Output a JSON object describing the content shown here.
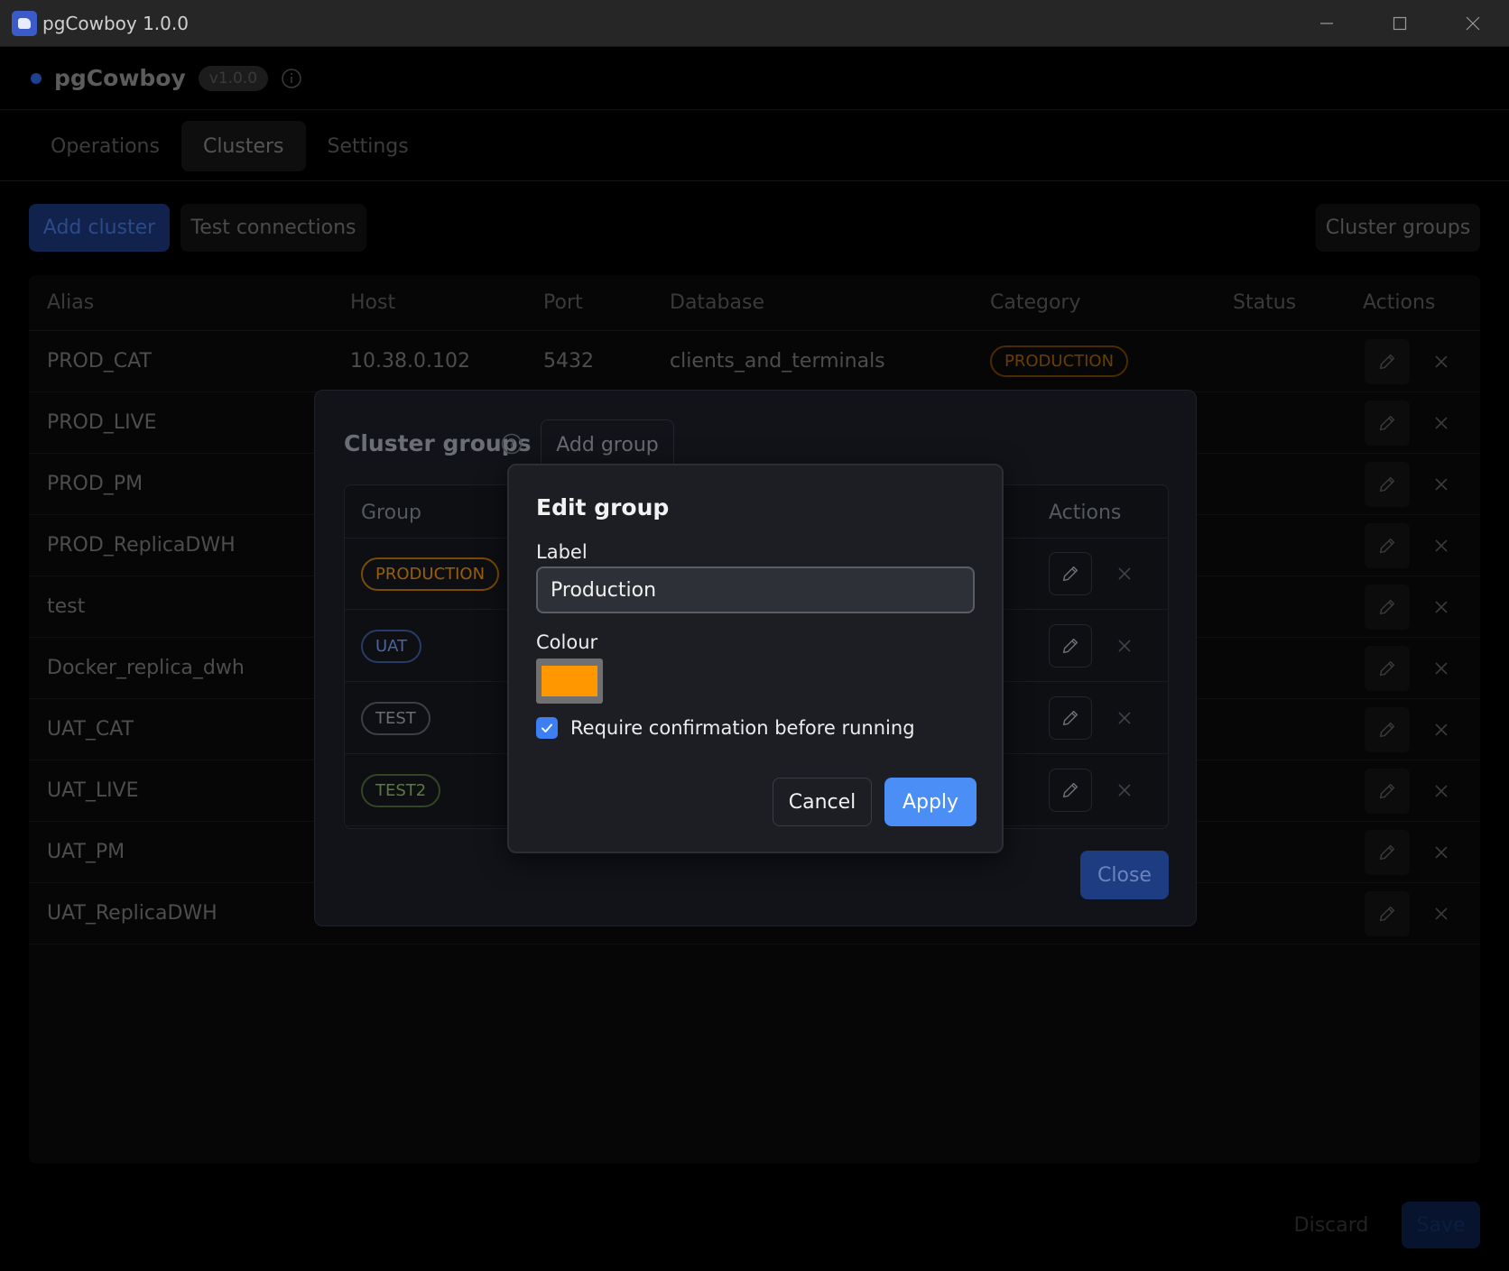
{
  "window": {
    "title": "pgCowboy 1.0.0"
  },
  "header": {
    "brand": "pgCowboy",
    "version": "v1.0.0"
  },
  "tabs": [
    {
      "label": "Operations",
      "active": false
    },
    {
      "label": "Clusters",
      "active": true
    },
    {
      "label": "Settings",
      "active": false
    }
  ],
  "toolbar": {
    "add_cluster": "Add cluster",
    "test_connections": "Test connections",
    "cluster_groups": "Cluster groups"
  },
  "clusters_table": {
    "columns": [
      "Alias",
      "Host",
      "Port",
      "Database",
      "Category",
      "Status",
      "Actions"
    ],
    "rows": [
      {
        "alias": "PROD_CAT",
        "host": "10.38.0.102",
        "port": "5432",
        "database": "clients_and_terminals",
        "category": "PRODUCTION"
      },
      {
        "alias": "PROD_LIVE"
      },
      {
        "alias": "PROD_PM"
      },
      {
        "alias": "PROD_ReplicaDWH"
      },
      {
        "alias": "test"
      },
      {
        "alias": "Docker_replica_dwh"
      },
      {
        "alias": "UAT_CAT"
      },
      {
        "alias": "UAT_LIVE"
      },
      {
        "alias": "UAT_PM"
      },
      {
        "alias": "UAT_ReplicaDWH"
      }
    ]
  },
  "footer": {
    "discard": "Discard",
    "save": "Save"
  },
  "groups_modal": {
    "title": "Cluster groups",
    "add_group": "Add group",
    "columns": {
      "group": "Group",
      "actions": "Actions"
    },
    "groups": [
      {
        "label": "PRODUCTION",
        "variant": "production"
      },
      {
        "label": "UAT",
        "variant": "uat"
      },
      {
        "label": "TEST",
        "variant": "test"
      },
      {
        "label": "TEST2",
        "variant": "test2"
      }
    ],
    "close": "Close"
  },
  "edit_dialog": {
    "title": "Edit group",
    "label_caption": "Label",
    "label_value": "Production",
    "colour_caption": "Colour",
    "colour_value": "#ff9800",
    "require_confirmation_label": "Require confirmation before running",
    "require_confirmation_checked": true,
    "cancel": "Cancel",
    "apply": "Apply"
  },
  "colors": {
    "accent_blue": "#4a8ef6",
    "production_orange": "#ff9800"
  }
}
